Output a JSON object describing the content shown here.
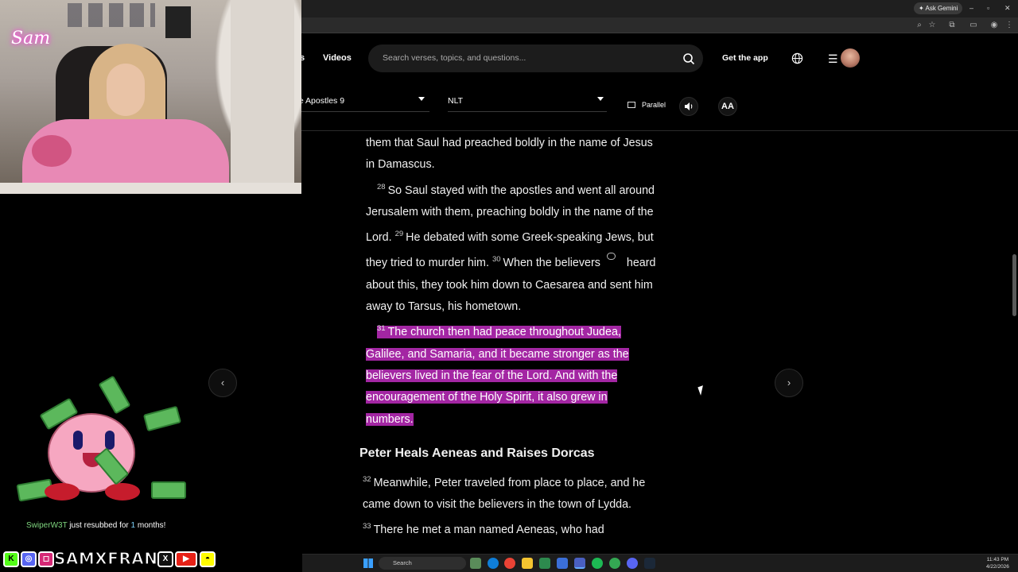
{
  "browser": {
    "gemini_label": "Ask Gemini",
    "window_controls": [
      "–",
      "▫",
      "✕"
    ]
  },
  "header": {
    "nav_partial": "s",
    "videos_label": "Videos",
    "search_placeholder": "Search verses, topics, and questions...",
    "get_app_label": "Get the app"
  },
  "toolbar": {
    "book_chapter": "he Apostles 9",
    "version": "NLT",
    "parallel_label": "Parallel",
    "font_label": "AA"
  },
  "reader": {
    "p1": "them that Saul had preached boldly in the name of Jesus in Damascus.",
    "v28_num": "28",
    "v28_text": "So Saul stayed with the apostles and went all around Jerusalem with them, preaching boldly in the name of the Lord.",
    "v29_num": "29",
    "v29_text": "He debated with some Greek-speaking Jews, but they tried to murder him.",
    "v30_num": "30",
    "v30_text_a": "When the believers",
    "v30_text_b": "heard about this, they took him down to Caesarea and sent him away to Tarsus, his hometown.",
    "v31_num": "31",
    "v31_text": "The church then had peace throughout Judea, Galilee, and Samaria, and it became stronger as the believers lived in the fear of the Lord. And with the encouragement of the Holy Spirit, it also grew in numbers.",
    "heading": "Peter Heals Aeneas and Raises Dorcas",
    "v32_num": "32",
    "v32_text": "Meanwhile, Peter traveled from place to place, and he came down to visit the believers in the town of Lydda.",
    "v33_num": "33",
    "v33_text": "There he met a man named Aeneas, who had"
  },
  "overlay": {
    "logo_text": "Sam",
    "alert_user": "SwiperW3T",
    "alert_mid": " just resubbed for ",
    "alert_count": "1",
    "alert_end": " months!",
    "streamer_name": "SAMXFRANK",
    "social_icons": [
      "kick-icon",
      "discord-icon",
      "instagram-icon",
      "x-icon",
      "youtube-icon",
      "snapchat-icon"
    ]
  },
  "taskbar": {
    "search_label": "Search",
    "time": "11:43 PM",
    "date": "4/22/2026"
  },
  "colors": {
    "highlight": "#a326a3",
    "background": "#000000"
  }
}
